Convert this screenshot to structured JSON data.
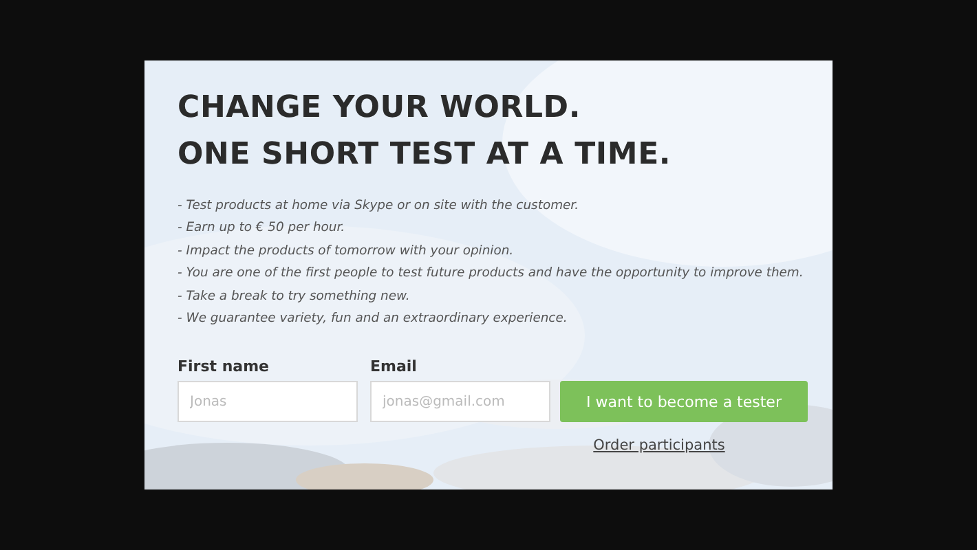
{
  "heading": [
    "CHANGE YOUR WORLD.",
    "ONE SHORT TEST AT A TIME."
  ],
  "bullets": [
    "- Test products at home via Skype or on site with the customer.",
    "- Earn up to € 50 per hour.",
    "- Impact the products of tomorrow with your opinion.",
    "- You are one of the first people to test future products and have the opportunity to improve them.",
    "- Take a break to try something new.",
    "- We guarantee variety, fun and an extraordinary experience."
  ],
  "form": {
    "fields": [
      {
        "label": "First name",
        "placeholder": "Jonas"
      },
      {
        "label": "Email",
        "placeholder": "jonas@gmail.com"
      }
    ],
    "button": "I want to become a tester",
    "link": "Order participants"
  }
}
